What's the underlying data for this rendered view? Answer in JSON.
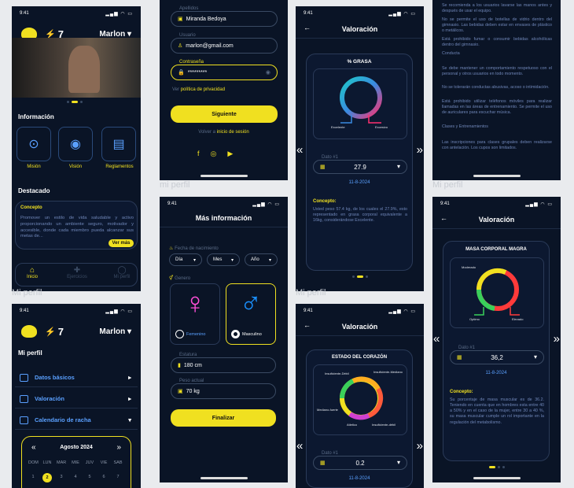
{
  "colors": {
    "accent": "#f0e020",
    "bg": "#0a1426",
    "blue": "#5aa0ff"
  },
  "status": {
    "time": "9:41"
  },
  "labels": {
    "mi_perfil_1": "Mi perfil",
    "mi_perfil_2": "mi perfil",
    "mi_perfil_3": "Mi perfil",
    "mi_perfil_4": "Mi perfil"
  },
  "home": {
    "streak": "7",
    "user": "Marlon",
    "info_title": "Información",
    "cards": [
      {
        "label": "Misión",
        "icon": "target-icon"
      },
      {
        "label": "Visión",
        "icon": "eye-icon"
      },
      {
        "label": "Reglamentos",
        "icon": "document-icon"
      }
    ],
    "featured_title": "Destacado",
    "concept_title": "Concepto",
    "concept_text": "Promover un estilo de vida saludable y activo proporcionando un ambiente seguro, motivador y accesible, donde cada miembro pueda alcanzar sus metas de...",
    "more": "Ver más",
    "nav": [
      "Inicio",
      "Ejercicios",
      "Mi perfil"
    ]
  },
  "profile": {
    "streak": "7",
    "user": "Marlon",
    "title": "Mi perfil",
    "menu": [
      "Datos básicos",
      "Valoración",
      "Calendario de racha"
    ],
    "month": "Agosto 2024",
    "days": [
      "DOM",
      "LUN",
      "MAR",
      "MIE",
      "JUV",
      "VIE",
      "SAB"
    ],
    "dates": [
      "1",
      "2",
      "3",
      "4",
      "5",
      "6",
      "7"
    ]
  },
  "register": {
    "fields": [
      {
        "label": "Apellidos",
        "value": "Miranda Bedoya"
      },
      {
        "label": "Usuario",
        "value": "marlon@gmail.com"
      },
      {
        "label": "Contraseña",
        "value": "*********"
      }
    ],
    "privacy_prefix": "Ver",
    "privacy_link": "política de privacidad",
    "next": "Siguiente",
    "back_prefix": "Volver a",
    "back_link": "inicio de sesión"
  },
  "moreinfo": {
    "title": "Más información",
    "birth_label": "Fecha de nacimiento",
    "day": "Día",
    "month": "Mes",
    "year": "Año",
    "gender_label": "Genero",
    "female": "Femenino",
    "male": "Masculino",
    "height_label": "Estatura",
    "height": "180 cm",
    "weight_label": "Peso actual",
    "weight": "70 kg",
    "finish": "Finalizar"
  },
  "fat": {
    "title": "Valoración",
    "card_title": "% GRASA",
    "legend": [
      "Excelente",
      "Excesivo"
    ],
    "dato_label": "Dato #1",
    "value": "27.9",
    "date": "11-8-2024",
    "concept": "Concepto:",
    "text": "Usted peso 57.4 kg, de los cuales el 27.9%, esto representado en grasa corporal equivalente a 16kg, considerándose Excelente."
  },
  "heart": {
    "title": "Valoración",
    "card_title": "ESTADO DEL CORAZÓN",
    "legend": [
      "Insuficiente-Débil",
      "Insuficiente-Mediano",
      "Mediano-fuerte",
      "Atletico",
      "Insuficiente-débil"
    ],
    "dato_label": "Dato #1",
    "value": "0.2",
    "date": "11-8-2024"
  },
  "rules": {
    "p1": "Se recomienda a los usuarios lavarse las manos antes y después de usar el equipo.",
    "p2": "No se permite el uso de botellas de vidrio dentro del gimnasio. Las bebidas deben estar en envases de plástico o metálicos.",
    "p3": "Está prohibido fumar o consumir bebidas alcohólicas dentro del gimnasio.",
    "h1": "Conducta",
    "p4": "Se debe mantener un comportamiento respetuoso con el personal y otros usuarios en todo momento.",
    "p5": "No se tolerarán conductas abusivas, acoso o intimidación.",
    "p6": "Está prohibido utilizar teléfonos móviles para realizar llamadas en las áreas de entrenamiento. Se permite el uso de auriculares para escuchar música.",
    "h2": "Clases y Entrenamientos",
    "p7": "Las inscripciones para clases grupales deben realizarse con antelación. Los cupos son limitados."
  },
  "muscle": {
    "title": "Valoración",
    "card_title": "MASA CORPORAL MAGRA",
    "legend": [
      "Moderado",
      "Optimo",
      "Elevado"
    ],
    "dato_label": "Dato #1",
    "value": "36,2",
    "date": "11-8-2024",
    "concept": "Concepto:",
    "text": "Su porcentaje de masa muscular es de 36.2. Teniendo en cuenta que en hombres esta entre 40 a 50% y en el caso de la mujer, entre 30 a 40 %, su masa muscular cumple un rol importante en la regulación del metabolismo."
  }
}
